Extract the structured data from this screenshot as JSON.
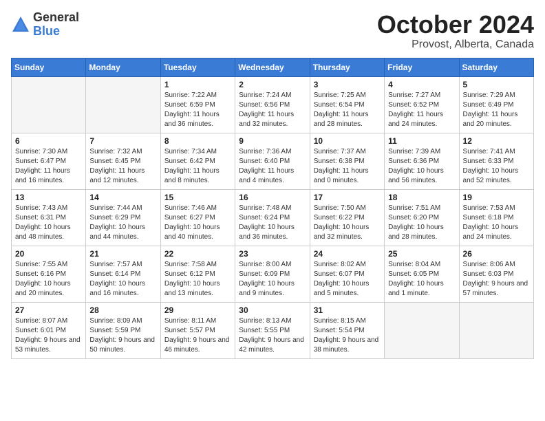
{
  "header": {
    "logo_general": "General",
    "logo_blue": "Blue",
    "month_title": "October 2024",
    "location": "Provost, Alberta, Canada"
  },
  "days_of_week": [
    "Sunday",
    "Monday",
    "Tuesday",
    "Wednesday",
    "Thursday",
    "Friday",
    "Saturday"
  ],
  "weeks": [
    [
      {
        "num": "",
        "sunrise": "",
        "sunset": "",
        "daylight": ""
      },
      {
        "num": "",
        "sunrise": "",
        "sunset": "",
        "daylight": ""
      },
      {
        "num": "1",
        "sunrise": "Sunrise: 7:22 AM",
        "sunset": "Sunset: 6:59 PM",
        "daylight": "Daylight: 11 hours and 36 minutes."
      },
      {
        "num": "2",
        "sunrise": "Sunrise: 7:24 AM",
        "sunset": "Sunset: 6:56 PM",
        "daylight": "Daylight: 11 hours and 32 minutes."
      },
      {
        "num": "3",
        "sunrise": "Sunrise: 7:25 AM",
        "sunset": "Sunset: 6:54 PM",
        "daylight": "Daylight: 11 hours and 28 minutes."
      },
      {
        "num": "4",
        "sunrise": "Sunrise: 7:27 AM",
        "sunset": "Sunset: 6:52 PM",
        "daylight": "Daylight: 11 hours and 24 minutes."
      },
      {
        "num": "5",
        "sunrise": "Sunrise: 7:29 AM",
        "sunset": "Sunset: 6:49 PM",
        "daylight": "Daylight: 11 hours and 20 minutes."
      }
    ],
    [
      {
        "num": "6",
        "sunrise": "Sunrise: 7:30 AM",
        "sunset": "Sunset: 6:47 PM",
        "daylight": "Daylight: 11 hours and 16 minutes."
      },
      {
        "num": "7",
        "sunrise": "Sunrise: 7:32 AM",
        "sunset": "Sunset: 6:45 PM",
        "daylight": "Daylight: 11 hours and 12 minutes."
      },
      {
        "num": "8",
        "sunrise": "Sunrise: 7:34 AM",
        "sunset": "Sunset: 6:42 PM",
        "daylight": "Daylight: 11 hours and 8 minutes."
      },
      {
        "num": "9",
        "sunrise": "Sunrise: 7:36 AM",
        "sunset": "Sunset: 6:40 PM",
        "daylight": "Daylight: 11 hours and 4 minutes."
      },
      {
        "num": "10",
        "sunrise": "Sunrise: 7:37 AM",
        "sunset": "Sunset: 6:38 PM",
        "daylight": "Daylight: 11 hours and 0 minutes."
      },
      {
        "num": "11",
        "sunrise": "Sunrise: 7:39 AM",
        "sunset": "Sunset: 6:36 PM",
        "daylight": "Daylight: 10 hours and 56 minutes."
      },
      {
        "num": "12",
        "sunrise": "Sunrise: 7:41 AM",
        "sunset": "Sunset: 6:33 PM",
        "daylight": "Daylight: 10 hours and 52 minutes."
      }
    ],
    [
      {
        "num": "13",
        "sunrise": "Sunrise: 7:43 AM",
        "sunset": "Sunset: 6:31 PM",
        "daylight": "Daylight: 10 hours and 48 minutes."
      },
      {
        "num": "14",
        "sunrise": "Sunrise: 7:44 AM",
        "sunset": "Sunset: 6:29 PM",
        "daylight": "Daylight: 10 hours and 44 minutes."
      },
      {
        "num": "15",
        "sunrise": "Sunrise: 7:46 AM",
        "sunset": "Sunset: 6:27 PM",
        "daylight": "Daylight: 10 hours and 40 minutes."
      },
      {
        "num": "16",
        "sunrise": "Sunrise: 7:48 AM",
        "sunset": "Sunset: 6:24 PM",
        "daylight": "Daylight: 10 hours and 36 minutes."
      },
      {
        "num": "17",
        "sunrise": "Sunrise: 7:50 AM",
        "sunset": "Sunset: 6:22 PM",
        "daylight": "Daylight: 10 hours and 32 minutes."
      },
      {
        "num": "18",
        "sunrise": "Sunrise: 7:51 AM",
        "sunset": "Sunset: 6:20 PM",
        "daylight": "Daylight: 10 hours and 28 minutes."
      },
      {
        "num": "19",
        "sunrise": "Sunrise: 7:53 AM",
        "sunset": "Sunset: 6:18 PM",
        "daylight": "Daylight: 10 hours and 24 minutes."
      }
    ],
    [
      {
        "num": "20",
        "sunrise": "Sunrise: 7:55 AM",
        "sunset": "Sunset: 6:16 PM",
        "daylight": "Daylight: 10 hours and 20 minutes."
      },
      {
        "num": "21",
        "sunrise": "Sunrise: 7:57 AM",
        "sunset": "Sunset: 6:14 PM",
        "daylight": "Daylight: 10 hours and 16 minutes."
      },
      {
        "num": "22",
        "sunrise": "Sunrise: 7:58 AM",
        "sunset": "Sunset: 6:12 PM",
        "daylight": "Daylight: 10 hours and 13 minutes."
      },
      {
        "num": "23",
        "sunrise": "Sunrise: 8:00 AM",
        "sunset": "Sunset: 6:09 PM",
        "daylight": "Daylight: 10 hours and 9 minutes."
      },
      {
        "num": "24",
        "sunrise": "Sunrise: 8:02 AM",
        "sunset": "Sunset: 6:07 PM",
        "daylight": "Daylight: 10 hours and 5 minutes."
      },
      {
        "num": "25",
        "sunrise": "Sunrise: 8:04 AM",
        "sunset": "Sunset: 6:05 PM",
        "daylight": "Daylight: 10 hours and 1 minute."
      },
      {
        "num": "26",
        "sunrise": "Sunrise: 8:06 AM",
        "sunset": "Sunset: 6:03 PM",
        "daylight": "Daylight: 9 hours and 57 minutes."
      }
    ],
    [
      {
        "num": "27",
        "sunrise": "Sunrise: 8:07 AM",
        "sunset": "Sunset: 6:01 PM",
        "daylight": "Daylight: 9 hours and 53 minutes."
      },
      {
        "num": "28",
        "sunrise": "Sunrise: 8:09 AM",
        "sunset": "Sunset: 5:59 PM",
        "daylight": "Daylight: 9 hours and 50 minutes."
      },
      {
        "num": "29",
        "sunrise": "Sunrise: 8:11 AM",
        "sunset": "Sunset: 5:57 PM",
        "daylight": "Daylight: 9 hours and 46 minutes."
      },
      {
        "num": "30",
        "sunrise": "Sunrise: 8:13 AM",
        "sunset": "Sunset: 5:55 PM",
        "daylight": "Daylight: 9 hours and 42 minutes."
      },
      {
        "num": "31",
        "sunrise": "Sunrise: 8:15 AM",
        "sunset": "Sunset: 5:54 PM",
        "daylight": "Daylight: 9 hours and 38 minutes."
      },
      {
        "num": "",
        "sunrise": "",
        "sunset": "",
        "daylight": ""
      },
      {
        "num": "",
        "sunrise": "",
        "sunset": "",
        "daylight": ""
      }
    ]
  ]
}
